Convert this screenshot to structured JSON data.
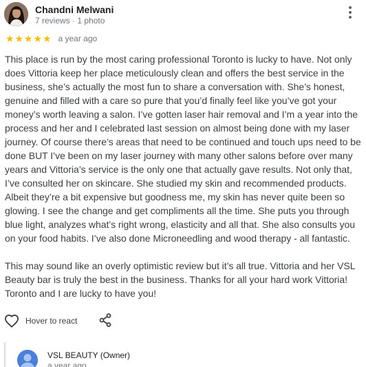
{
  "reviewer": {
    "name": "Chandni Melwani",
    "meta": "7 reviews · 1 photo"
  },
  "rating": {
    "stars": 5,
    "star_color": "#fbbc04",
    "date": "a year ago"
  },
  "review": {
    "paragraphs": [
      "This place is run by the most caring professional Toronto is lucky to have. Not only does Vittoria keep her place meticulously clean and offers the best service in the business, she’s actually the most fun to share a conversation with. She’s honest, genuine and filled with a care so pure that you’d finally feel like you’ve got your money’s worth leaving a salon. I’ve gotten laser hair removal and I’m a year into the process and her and I celebrated last session on almost being done with my laser journey. Of course there’s areas that need to be continued and touch ups need to be done BUT I’ve been on my laser journey with many other salons before over many years and Vittoria’s service is the only one that actually gave results. Not only that, I’ve consulted her on skincare. She studied my skin and recommended products. Albeit they’re a bit expensive but goodness me, my skin has never quite been so glowing. I see the change and get compliments all the time. She puts you through blue light, analyzes what’s right wrong, elasticity and all that. She also consults you on your food habits. I’ve also done Microneedling and wood therapy - all fantastic.",
      "This may sound like an overly optimistic review but it’s all true. Vittoria and her VSL Beauty bar is truly the best in the business. Thanks for all your hard work Vittoria! Toronto and I are lucky to have you!"
    ]
  },
  "actions": {
    "react_label": "Hover to react",
    "react_icon": "heart-outline-icon",
    "share_icon": "share-icon"
  },
  "owner_response": {
    "name": "VSL BEAUTY (Owner)",
    "date": "a year ago"
  }
}
